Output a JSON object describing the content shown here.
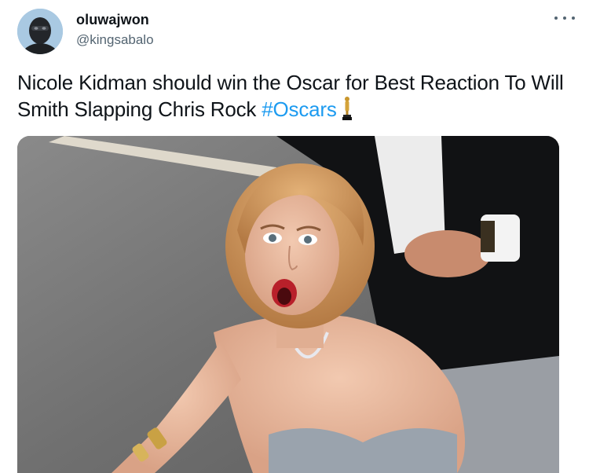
{
  "user": {
    "display_name": "oluwajwon",
    "handle": "@kingsabalo",
    "avatar_icon": "masked-person-avatar"
  },
  "tweet": {
    "text": "Nicole Kidman should win the Oscar for Best Reaction To Will Smith Slapping Chris Rock ",
    "hashtag": "#Oscars",
    "emoji_icon": "oscar-statue-icon"
  },
  "menu": {
    "icon": "more-options-icon"
  },
  "media": {
    "description_icon": "photo-woman-shocked-reaction"
  },
  "colors": {
    "link": "#1d9bf0",
    "secondary_text": "#536471",
    "primary_text": "#0f1419"
  }
}
